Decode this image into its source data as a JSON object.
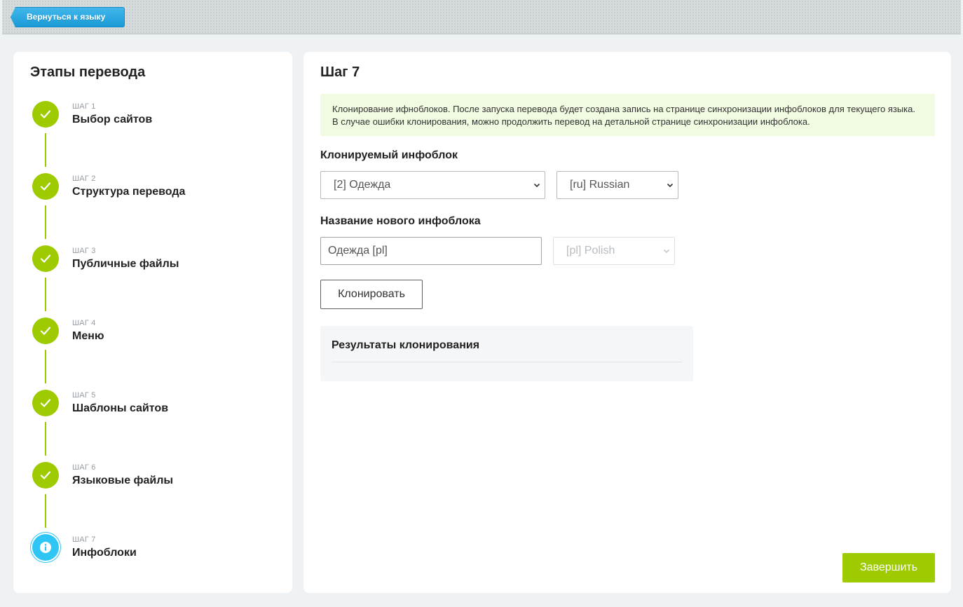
{
  "toolbar": {
    "back_label": "Вернуться к языку"
  },
  "steps_panel": {
    "title": "Этапы перевода",
    "steps": [
      {
        "num": "ШАГ 1",
        "label": "Выбор сайтов",
        "state": "done"
      },
      {
        "num": "ШАГ 2",
        "label": "Структура перевода",
        "state": "done"
      },
      {
        "num": "ШАГ 3",
        "label": "Публичные файлы",
        "state": "done"
      },
      {
        "num": "ШАГ 4",
        "label": "Меню",
        "state": "done"
      },
      {
        "num": "ШАГ 5",
        "label": "Шаблоны сайтов",
        "state": "done"
      },
      {
        "num": "ШАГ 6",
        "label": "Языковые файлы",
        "state": "done"
      },
      {
        "num": "ШАГ 7",
        "label": "Инфоблоки",
        "state": "current"
      }
    ]
  },
  "main": {
    "title": "Шаг 7",
    "alert_text": "Клонирование ифноблоков. После запуска перевода будет создана запись на странице синхронизации инфоблоков для текущего языка. В случае ошибки клонирования, можно продолжить перевод на детальной странице синхронизации инфоблока.",
    "source_label": "Клонируемый инфоблок",
    "source_iblock": "[2] Одежда",
    "source_lang": "[ru] Russian",
    "new_name_label": "Название нового инфоблока",
    "new_name_value": "Одежда [pl]",
    "target_lang": "[pl] Polish",
    "clone_button": "Клонировать",
    "results_title": "Результаты клонирования",
    "finish_button": "Завершить"
  },
  "colors": {
    "accent_green": "#9dcb00",
    "accent_blue": "#2fc6f6",
    "back_button_blue": "#1b9ad6",
    "alert_bg": "#f1fbe2"
  }
}
